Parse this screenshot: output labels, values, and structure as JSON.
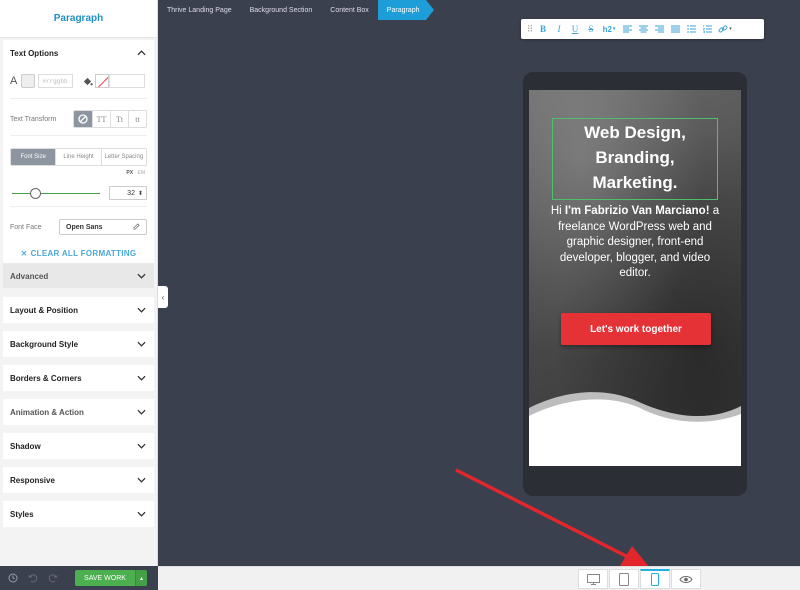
{
  "sidebar": {
    "title": "Paragraph",
    "text_options": {
      "title": "Text Options",
      "font_color_label": "A",
      "font_color_value": "#rrggbb",
      "text_transform_label": "Text Transform",
      "transform_options": [
        "TT",
        "Tt",
        "tt"
      ],
      "size_tabs": [
        "Font Size",
        "Line Height",
        "Letter Spacing"
      ],
      "unit_px": "PX",
      "unit_sep": "·",
      "unit_em": "EM",
      "font_size": "32",
      "font_face_label": "Font Face",
      "font_face_value": "Open Sans",
      "clear_formatting": "CLEAR ALL FORMATTING"
    },
    "advanced": "Advanced",
    "panels": [
      "Layout & Position",
      "Background Style",
      "Borders & Corners",
      "Animation & Action",
      "Shadow",
      "Responsive",
      "Styles"
    ]
  },
  "bottom_bar": {
    "save_label": "SAVE WORK"
  },
  "breadcrumb": [
    "Thrive Landing Page",
    "Background Section",
    "Content Box",
    "Paragraph"
  ],
  "toolbar": {
    "heading_label": "h2"
  },
  "preview": {
    "headline_lines": [
      "Web Design,",
      "Branding,",
      "Marketing."
    ],
    "intro_prefix": "Hi ",
    "intro_bold": "I'm Fabrizio Van Marciano!",
    "intro_rest": " a freelance WordPress web and graphic designer, front-end developer, blogger, and video editor.",
    "cta_label": "Let's work together"
  },
  "colors": {
    "accent": "#1e9ed8",
    "save_green": "#4caf50",
    "cta_red": "#e53237",
    "canvas": "#3b404e",
    "arrow": "#e3262b"
  }
}
